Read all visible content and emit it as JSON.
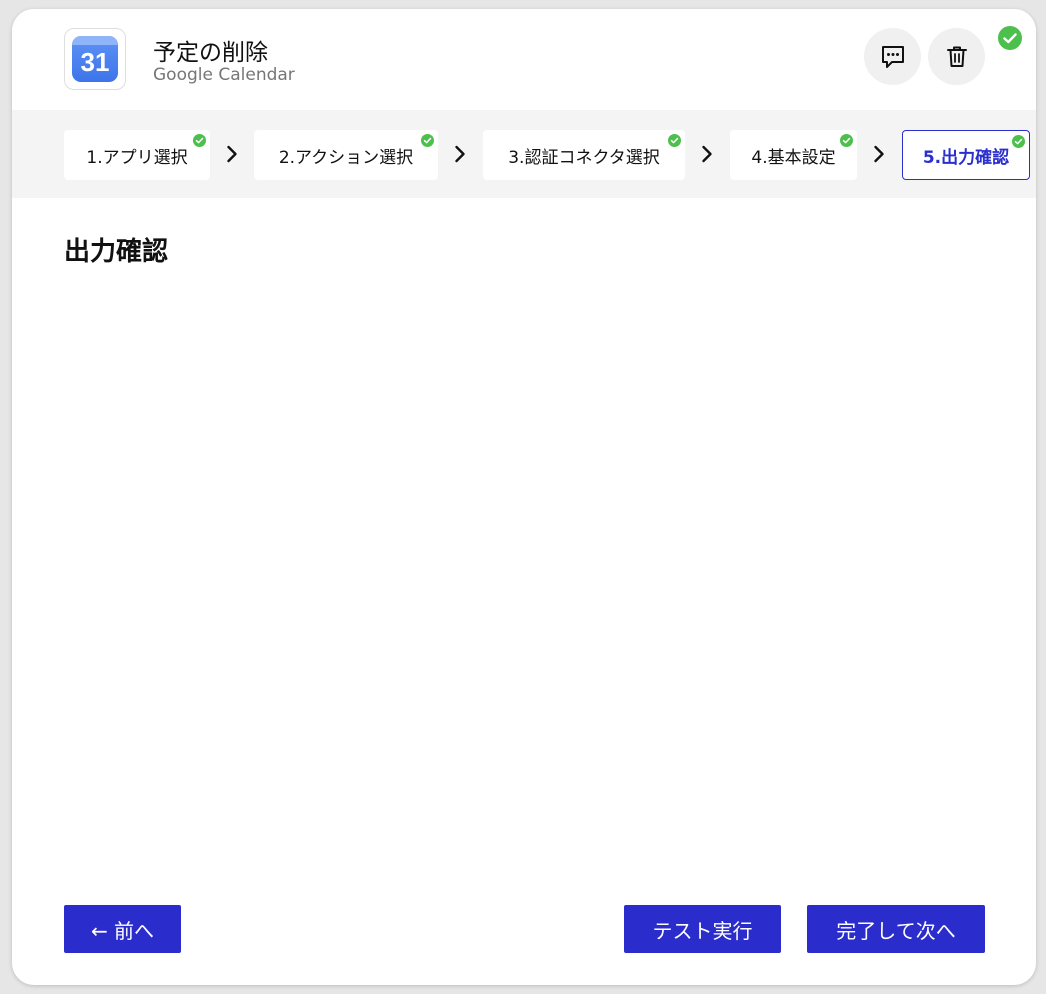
{
  "header": {
    "app_icon_text": "31",
    "title": "予定の削除",
    "subtitle": "Google Calendar",
    "comment_icon": "comment-icon",
    "trash_icon": "trash-icon",
    "status_icon": "check-circle-icon"
  },
  "steps": [
    {
      "label": "1.アプリ選択",
      "completed": true,
      "active": false
    },
    {
      "label": "2.アクション選択",
      "completed": true,
      "active": false
    },
    {
      "label": "3.認証コネクタ選択",
      "completed": true,
      "active": false
    },
    {
      "label": "4.基本設定",
      "completed": true,
      "active": false
    },
    {
      "label": "5.出力確認",
      "completed": true,
      "active": true
    }
  ],
  "main": {
    "section_title": "出力確認"
  },
  "footer": {
    "back_label": "← 前へ",
    "test_label": "テスト実行",
    "finish_label": "完了して次へ"
  },
  "colors": {
    "accent": "#2b2ccc",
    "check_green": "#4cbf4c",
    "step_bar_bg": "#f4f4f4"
  }
}
